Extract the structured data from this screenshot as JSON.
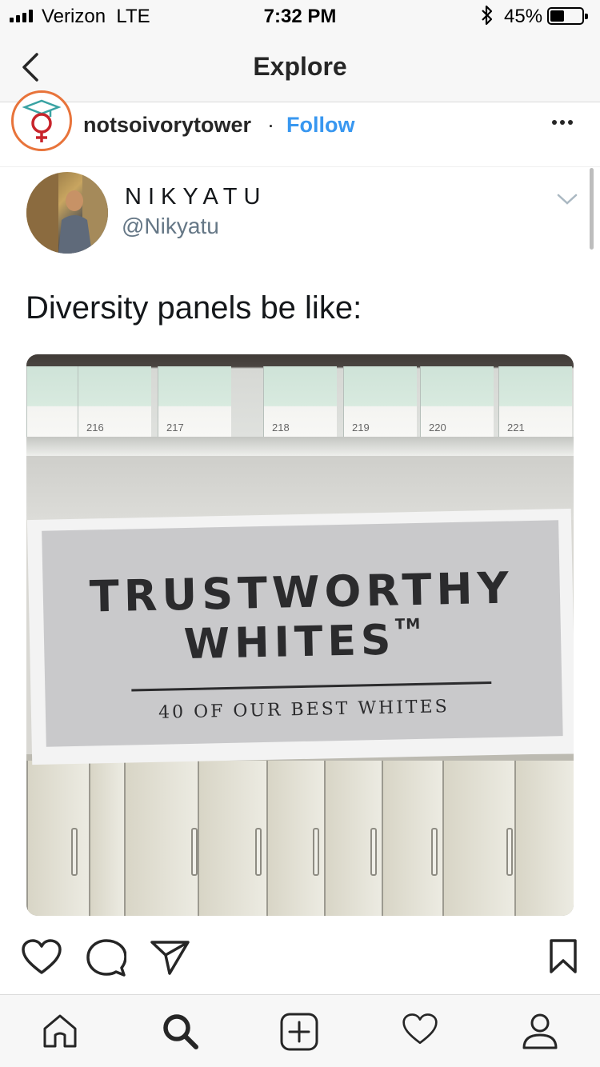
{
  "status_bar": {
    "carrier": "Verizon",
    "network": "LTE",
    "time": "7:32 PM",
    "battery_percent": "45%",
    "battery_level": 0.45
  },
  "nav": {
    "title": "Explore",
    "back_icon": "chevron-left-icon"
  },
  "post": {
    "username": "notsoivorytower",
    "separator": "·",
    "follow_label": "Follow",
    "more_icon": "more-horizontal-icon",
    "avatar_icon": "venus-graduation-cap-logo"
  },
  "tweet": {
    "display_name": "NIKYATU",
    "handle": "@Nikyatu",
    "text": "Diversity panels be like:",
    "photo": {
      "chip_numbers": [
        "216",
        "217",
        "218",
        "219",
        "220",
        "221"
      ],
      "sign_line1": "TRUSTWORTHY",
      "sign_line2": "WHITES",
      "trademark": "TM",
      "sign_subtitle": "40 OF OUR BEST WHITES"
    }
  },
  "actions": {
    "like_icon": "heart-icon",
    "comment_icon": "comment-icon",
    "share_icon": "send-icon",
    "save_icon": "bookmark-icon"
  },
  "tab_bar": {
    "items": [
      "home-icon",
      "search-icon",
      "add-icon",
      "activity-heart-icon",
      "profile-icon"
    ],
    "active": "search-icon"
  },
  "colors": {
    "follow": "#3897f0",
    "text": "#262626",
    "handle": "#657786",
    "bar_bg": "#f7f7f7",
    "avatar_ring": "#e8743b"
  }
}
